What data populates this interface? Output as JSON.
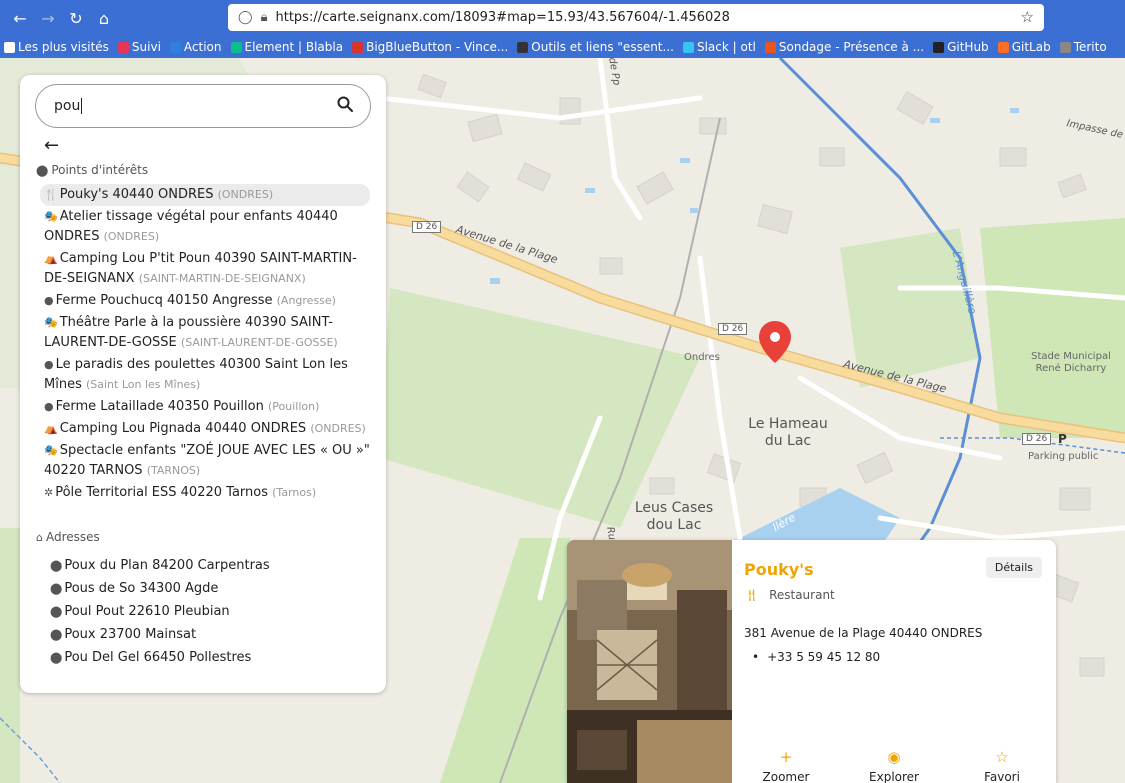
{
  "browser": {
    "url": "https://carte.seignanx.com/18093#map=15.93/43.567604/-1.456028",
    "bookmarks": [
      {
        "label": "Les plus visités",
        "color": "#ffffff"
      },
      {
        "label": "Suivi",
        "color": "#e5365a"
      },
      {
        "label": "Action",
        "color": "#2f7fe0"
      },
      {
        "label": "Element | Blabla",
        "color": "#0dbd8b"
      },
      {
        "label": "BigBlueButton - Vince...",
        "color": "#d7352b"
      },
      {
        "label": "Outils et liens \"essent...",
        "color": "#333333"
      },
      {
        "label": "Slack | otl",
        "color": "#36c5f0"
      },
      {
        "label": "Sondage - Présence à ...",
        "color": "#e8551f"
      },
      {
        "label": "GitHub",
        "color": "#222222"
      },
      {
        "label": "GitLab",
        "color": "#fc6d26"
      },
      {
        "label": "Terito",
        "color": "#888888"
      }
    ]
  },
  "search": {
    "value": "pou",
    "back_icon": "arrow-left-icon",
    "search_icon": "magnifier-icon"
  },
  "poi_section": {
    "title": "Points d'intérêts",
    "items": [
      {
        "icon": "restaurant-icon",
        "glyph": "🍴",
        "name": "Pouky's 40440 ONDRES",
        "city": "(ONDRES)"
      },
      {
        "icon": "theatre-icon",
        "glyph": "🎭",
        "name": "Atelier tissage végétal pour enfants 40440 ONDRES",
        "city": "(ONDRES)"
      },
      {
        "icon": "camping-icon",
        "glyph": "⛺",
        "name": "Camping Lou P'tit Poun 40390 SAINT-MARTIN-DE-SEIGNANX",
        "city": "(SAINT-MARTIN-DE-SEIGNANX)"
      },
      {
        "icon": "farm-icon",
        "glyph": "●",
        "name": "Ferme Pouchucq 40150 Angresse",
        "city": "(Angresse)"
      },
      {
        "icon": "theatre-icon",
        "glyph": "🎭",
        "name": "Théâtre Parle à la poussière 40390 SAINT-LAURENT-DE-GOSSE",
        "city": "(SAINT-LAURENT-DE-GOSSE)"
      },
      {
        "icon": "farm-icon",
        "glyph": "●",
        "name": "Le paradis des poulettes 40300 Saint Lon les Mînes",
        "city": "(Saint Lon les Mînes)"
      },
      {
        "icon": "farm-icon",
        "glyph": "●",
        "name": "Ferme Lataillade 40350 Pouillon",
        "city": "(Pouillon)"
      },
      {
        "icon": "camping-icon",
        "glyph": "⛺",
        "name": "Camping Lou Pignada 40440 ONDRES",
        "city": "(ONDRES)"
      },
      {
        "icon": "theatre-icon",
        "glyph": "🎭",
        "name": "Spectacle enfants \"ZOÉ JOUE AVEC LES « OU »\" 40220 TARNOS",
        "city": "(TARNOS)"
      },
      {
        "icon": "office-icon",
        "glyph": "✲",
        "name": "Pôle Territorial ESS 40220 Tarnos",
        "city": "(Tarnos)"
      }
    ]
  },
  "address_section": {
    "title": "Adresses",
    "items": [
      "Poux du Plan 84200 Carpentras",
      "Pous de So 34300 Agde",
      "Poul Pout 22610 Pleubian",
      "Poux 23700 Mainsat",
      "Pou Del Gel 66450 Pollestres"
    ]
  },
  "map": {
    "labels": {
      "road_main": "Avenue de la Plage",
      "road_main_2": "Avenue de la Plage",
      "d26_a": "D 26",
      "d26_b": "D 26",
      "d26_c": "D 26",
      "hameau": "Le Hameau du Lac",
      "leus": "Leus Cases dou Lac",
      "ondres": "Ondres",
      "stade": "Stade Municipal René Dicharry",
      "parking": "Parking public",
      "parking_p": "P",
      "impasse": "Impasse de",
      "anguillere": "L'Anguillère",
      "de_pp": "de Pp",
      "rue_frag": "Ru",
      "lac_frag": "llère"
    }
  },
  "card": {
    "title": "Pouky's",
    "category": "Restaurant",
    "details_label": "Détails",
    "address": "381 Avenue de la Plage 40440 ONDRES",
    "phone": "+33 5 59 45 12 80",
    "actions": [
      {
        "label": "Zoomer",
        "icon": "plus-icon",
        "glyph": "+"
      },
      {
        "label": "Explorer",
        "icon": "eye-icon",
        "glyph": "◉"
      },
      {
        "label": "Favori",
        "icon": "star-icon",
        "glyph": "☆"
      }
    ]
  },
  "colors": {
    "accent": "#f0a400",
    "marker": "#e8413a",
    "browser": "#3b6fd4"
  }
}
